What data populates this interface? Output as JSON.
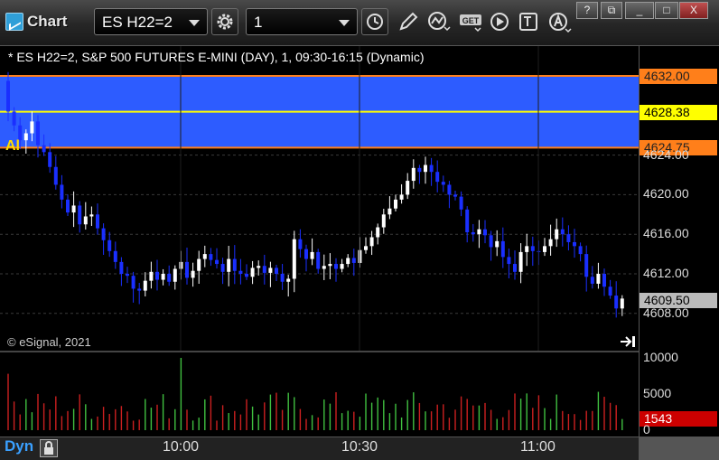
{
  "window": {
    "title": "Chart",
    "minimize": "?",
    "restore": "⧉",
    "maximize": "□",
    "close": "X"
  },
  "toolbar": {
    "symbol": "ES H22=2",
    "interval": "1",
    "icons": [
      "settings-gear-icon",
      "time-clock-icon",
      "draw-pencil-icon",
      "studies-wave-icon",
      "get-data-icon",
      "play-icon",
      "template-icon",
      "alert-icon"
    ]
  },
  "chart_header": "* ES H22=2, S&P 500 FUTURES E-MINI (DAY), 1, 09:30-16:15 (Dynamic)",
  "copyright": "© eSignal, 2021",
  "alert_label": "Al",
  "price_tags": {
    "upper": "4632.00",
    "last_line": "4628.38",
    "lower": "4624.75",
    "current": "4609.50",
    "volume_current": "1543"
  },
  "colors": {
    "zone": "#2d5cff",
    "orange_line": "#ff7f1a",
    "yellow_line": "#ffff00",
    "up_candle": "#ffffff",
    "down_candle": "#1a2fff",
    "vol_up": "#40c040",
    "vol_down": "#cc2020"
  },
  "bottom": {
    "mode": "Dyn"
  },
  "chart_data": [
    {
      "type": "candlestick",
      "title": "* ES H22=2, S&P 500 FUTURES E-MINI (DAY), 1, 09:30-16:15 (Dynamic)",
      "y_ticks": [
        "4624.00",
        "4620.00",
        "4616.00",
        "4612.00",
        "4608.00"
      ],
      "x_ticks": [
        "10:00",
        "10:30",
        "11:00"
      ],
      "ylim": [
        4606.0,
        4634.0
      ],
      "zone": [
        4624.75,
        4632.0
      ],
      "levels": [
        4632.0,
        4628.38,
        4624.75
      ],
      "last": 4609.5,
      "closes": [
        4628.4,
        4627.0,
        4625.5,
        4626.2,
        4627.4,
        4625.0,
        4624.3,
        4622.8,
        4621.0,
        4619.5,
        4618.2,
        4618.9,
        4617.0,
        4617.8,
        4618.0,
        4616.6,
        4615.4,
        4614.3,
        4613.2,
        4612.0,
        4611.8,
        4610.5,
        4610.3,
        4611.3,
        4612.2,
        4611.4,
        4612.0,
        4611.2,
        4612.5,
        4613.2,
        4611.6,
        4612.3,
        4613.5,
        4614.0,
        4613.4,
        4613.0,
        4612.2,
        4613.5,
        4612.3,
        4612.0,
        4611.7,
        4612.6,
        4612.8,
        4612.1,
        4612.6,
        4612.0,
        4611.2,
        4611.5,
        4615.5,
        4614.5,
        4613.5,
        4614.2,
        4612.5,
        4612.8,
        4613.0,
        4612.5,
        4613.0,
        4613.6,
        4613.1,
        4614.4,
        4614.8,
        4615.7,
        4616.7,
        4618.0,
        4618.6,
        4619.5,
        4620.0,
        4621.4,
        4622.7,
        4622.3,
        4623.0,
        4622.3,
        4621.3,
        4621.0,
        4620.0,
        4619.8,
        4618.5,
        4616.2,
        4616.0,
        4616.5,
        4615.9,
        4614.7,
        4615.3,
        4613.7,
        4613.0,
        4612.2,
        4614.2,
        4614.8,
        4614.3,
        4614.2,
        4614.8,
        4615.5,
        4616.5,
        4616.0,
        4615.2,
        4614.8,
        4614.0,
        4611.7,
        4611.0,
        4612.0,
        4610.7,
        4609.8,
        4608.5,
        4609.5
      ],
      "volume_ticks": [
        "10000",
        "5000",
        "0"
      ],
      "volume_last": 1543
    }
  ]
}
